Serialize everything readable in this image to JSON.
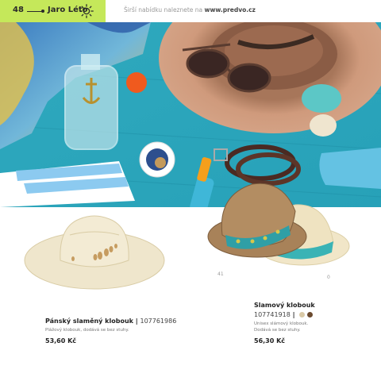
{
  "header": {
    "page_number": "48",
    "season": "Jaro Léto",
    "more_prefix": "Širší nabídku naleznete na ",
    "url": "www.predvo.cz"
  },
  "colors": {
    "tab_green": "#c5e85a",
    "swatch_beige": "#d9c9a7",
    "swatch_brown": "#6b4a2f"
  },
  "products": [
    {
      "title": "Pánský slaměný klobouk",
      "code": "107761986",
      "description": "Plážový klobouk, dodává se bez stuhy.",
      "price": "53,60 Kč"
    },
    {
      "title": "Slamový klobouk",
      "code": "107741918",
      "description_line1": "Unisex slámový klobouk.",
      "description_line2": "Dodává se bez stuhy.",
      "price": "56,30 Kč",
      "swatches": [
        "beige",
        "brown"
      ]
    }
  ],
  "item_labels": [
    "41",
    "0"
  ]
}
